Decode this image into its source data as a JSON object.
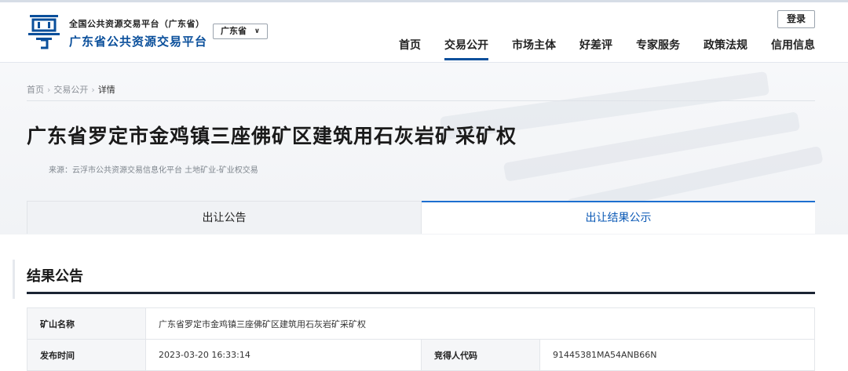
{
  "header": {
    "platform_sub": "全国公共资源交易平台（广东省）",
    "platform_name": "广东省公共资源交易平台",
    "region": "广东省",
    "login_label": "登录",
    "nav": [
      "首页",
      "交易公开",
      "市场主体",
      "好差评",
      "专家服务",
      "政策法规",
      "信用信息"
    ],
    "active_nav": "交易公开",
    "brand_color": "#0a4f9b"
  },
  "breadcrumb": [
    "首页",
    "交易公开",
    "详情"
  ],
  "detail": {
    "title": "广东省罗定市金鸡镇三座佛矿区建筑用石灰岩矿采矿权",
    "source": "来源：云浮市公共资源交易信息化平台  土地矿业-矿业权交易"
  },
  "tabs": [
    {
      "label": "出让公告",
      "active": false
    },
    {
      "label": "出让结果公示",
      "active": true
    }
  ],
  "result": {
    "section_title": "结果公告",
    "mine_name_label": "矿山名称",
    "mine_name": "广东省罗定市金鸡镇三座佛矿区建筑用石灰岩矿采矿权",
    "publish_time_label": "发布时间",
    "publish_time": "2023-03-20 16:33:14",
    "bidder_code_label": "竞得人代码",
    "bidder_code": "91445381MA54ANB66N"
  }
}
